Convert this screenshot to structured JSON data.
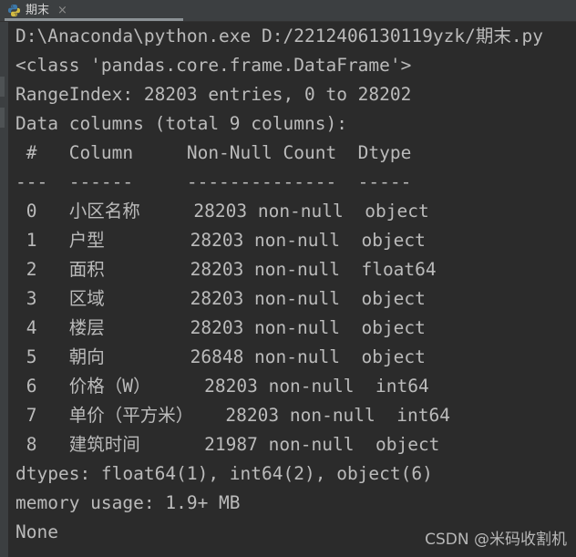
{
  "window": {
    "background_color": "#2b2b2b",
    "tabbar_color": "#3c3f41",
    "text_color": "#bbbbbb",
    "accent_underline_color": "#8c9296"
  },
  "tabbar": {
    "tab": {
      "icon": "python-file-icon",
      "label": "期末",
      "close_label": "×"
    }
  },
  "console": {
    "lines": [
      "D:\\Anaconda\\python.exe D:/2212406130119yzk/期末.py",
      "<class 'pandas.core.frame.DataFrame'>",
      "RangeIndex: 28203 entries, 0 to 28202",
      "Data columns (total 9 columns):",
      " #   Column     Non-Null Count  Dtype",
      "---  ------     --------------  -----",
      " 0   小区名称     28203 non-null  object",
      " 1   户型        28203 non-null  object",
      " 2   面积        28203 non-null  float64",
      " 3   区域        28203 non-null  object",
      " 4   楼层        28203 non-null  object",
      " 5   朝向        26848 non-null  object",
      " 6   价格（W）     28203 non-null  int64",
      " 7   单价（平方米）   28203 non-null  int64",
      " 8   建筑时间      21987 non-null  object",
      "dtypes: float64(1), int64(2), object(6)",
      "memory usage: 1.9+ MB",
      "None"
    ],
    "dataframe_info": {
      "class": "<class 'pandas.core.frame.DataFrame'>",
      "range_index": "RangeIndex: 28203 entries, 0 to 28202",
      "total_columns": "Data columns (total 9 columns):",
      "headers": [
        "#",
        "Column",
        "Non-Null Count",
        "Dtype"
      ],
      "rows": [
        {
          "index": "0",
          "column": "小区名称",
          "non_null": "28203 non-null",
          "dtype": "object"
        },
        {
          "index": "1",
          "column": "户型",
          "non_null": "28203 non-null",
          "dtype": "object"
        },
        {
          "index": "2",
          "column": "面积",
          "non_null": "28203 non-null",
          "dtype": "float64"
        },
        {
          "index": "3",
          "column": "区域",
          "non_null": "28203 non-null",
          "dtype": "object"
        },
        {
          "index": "4",
          "column": "楼层",
          "non_null": "28203 non-null",
          "dtype": "object"
        },
        {
          "index": "5",
          "column": "朝向",
          "non_null": "26848 non-null",
          "dtype": "object"
        },
        {
          "index": "6",
          "column": "价格（W）",
          "non_null": "28203 non-null",
          "dtype": "int64"
        },
        {
          "index": "7",
          "column": "单价（平方米）",
          "non_null": "28203 non-null",
          "dtype": "int64"
        },
        {
          "index": "8",
          "column": "建筑时间",
          "non_null": "21987 non-null",
          "dtype": "object"
        }
      ],
      "dtypes_summary": "dtypes: float64(1), int64(2), object(6)",
      "memory_usage": "memory usage: 1.9+ MB",
      "return_value": "None"
    },
    "command": "D:\\Anaconda\\python.exe D:/2212406130119yzk/期末.py"
  },
  "watermark": {
    "text": "CSDN @米码收割机"
  }
}
